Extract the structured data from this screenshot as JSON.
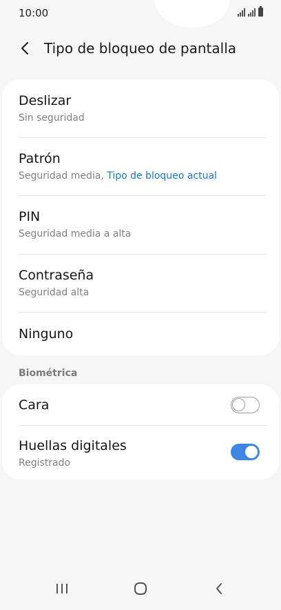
{
  "status_bar": {
    "time": "10:00"
  },
  "header": {
    "title": "Tipo de bloqueo de pantalla"
  },
  "lock_options": [
    {
      "title": "Deslizar",
      "subtitle": "Sin seguridad"
    },
    {
      "title": "Patrón",
      "subtitle": "Seguridad media, ",
      "subtitle_accent": "Tipo de bloqueo actual"
    },
    {
      "title": "PIN",
      "subtitle": "Seguridad media a alta"
    },
    {
      "title": "Contraseña",
      "subtitle": "Seguridad alta"
    },
    {
      "title": "Ninguno"
    }
  ],
  "biometrics": {
    "section_label": "Biométrica",
    "items": [
      {
        "title": "Cara",
        "enabled": false
      },
      {
        "title": "Huellas digitales",
        "subtitle": "Registrado",
        "enabled": true
      }
    ]
  },
  "colors": {
    "accent": "#1776c6",
    "toggle_on": "#3e87e6",
    "background": "#f6f6f6"
  },
  "nav": {
    "icons": [
      "recent-apps-icon",
      "home-icon",
      "back-icon"
    ]
  }
}
